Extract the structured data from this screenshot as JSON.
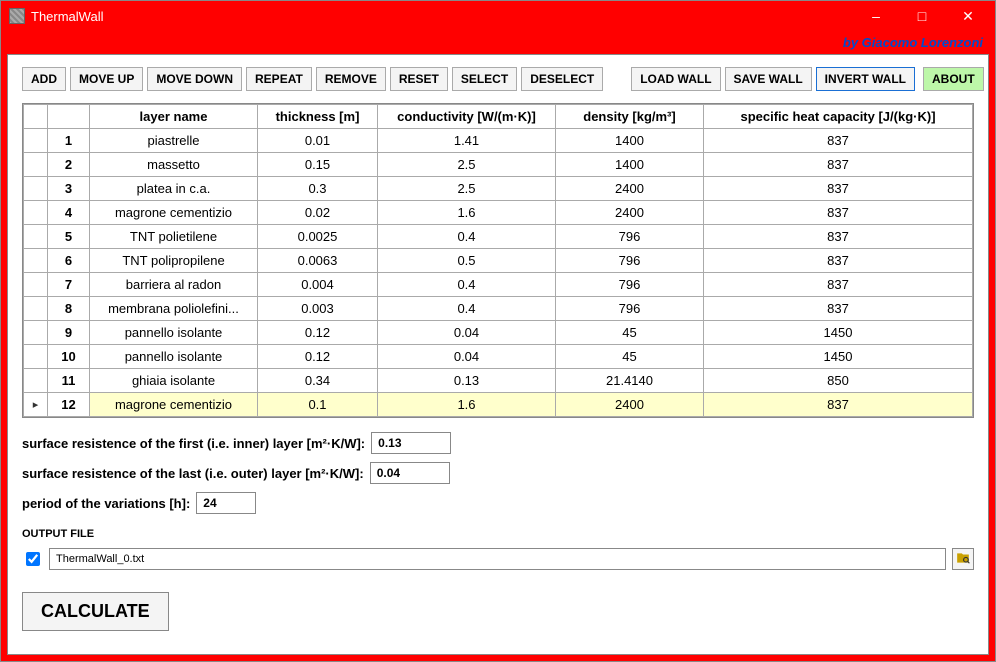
{
  "window": {
    "title": "ThermalWall",
    "credit": "by Giacomo Lorenzoni"
  },
  "toolbar": {
    "add": "ADD",
    "move_up": "MOVE UP",
    "move_down": "MOVE DOWN",
    "repeat": "REPEAT",
    "remove": "REMOVE",
    "reset": "RESET",
    "select": "SELECT",
    "deselect": "DESELECT",
    "load": "LOAD WALL",
    "save": "SAVE WALL",
    "invert": "INVERT WALL",
    "about": "ABOUT"
  },
  "table": {
    "headers": {
      "layer_name": "layer name",
      "thickness": "thickness  [m]",
      "conductivity": "conductivity  [W/(m·K)]",
      "density": "density  [kg/m³]",
      "shc": "specific heat capacity  [J/(kg·K)]"
    },
    "rows": [
      {
        "n": "1",
        "name": "piastrelle",
        "thk": "0.01",
        "cond": "1.41",
        "dens": "1400",
        "shc": "837"
      },
      {
        "n": "2",
        "name": "massetto",
        "thk": "0.15",
        "cond": "2.5",
        "dens": "1400",
        "shc": "837"
      },
      {
        "n": "3",
        "name": "platea in c.a.",
        "thk": "0.3",
        "cond": "2.5",
        "dens": "2400",
        "shc": "837"
      },
      {
        "n": "4",
        "name": "magrone cementizio",
        "thk": "0.02",
        "cond": "1.6",
        "dens": "2400",
        "shc": "837"
      },
      {
        "n": "5",
        "name": "TNT polietilene",
        "thk": "0.0025",
        "cond": "0.4",
        "dens": "796",
        "shc": "837"
      },
      {
        "n": "6",
        "name": "TNT polipropilene",
        "thk": "0.0063",
        "cond": "0.5",
        "dens": "796",
        "shc": "837"
      },
      {
        "n": "7",
        "name": "barriera al radon",
        "thk": "0.004",
        "cond": "0.4",
        "dens": "796",
        "shc": "837"
      },
      {
        "n": "8",
        "name": "membrana poliolefini...",
        "thk": "0.003",
        "cond": "0.4",
        "dens": "796",
        "shc": "837"
      },
      {
        "n": "9",
        "name": "pannello isolante",
        "thk": "0.12",
        "cond": "0.04",
        "dens": "45",
        "shc": "1450"
      },
      {
        "n": "10",
        "name": "pannello isolante",
        "thk": "0.12",
        "cond": "0.04",
        "dens": "45",
        "shc": "1450"
      },
      {
        "n": "11",
        "name": "ghiaia isolante",
        "thk": "0.34",
        "cond": "0.13",
        "dens": "21.4140",
        "shc": "850"
      },
      {
        "n": "12",
        "name": "magrone cementizio",
        "thk": "0.1",
        "cond": "1.6",
        "dens": "2400",
        "shc": "837",
        "selected": true,
        "marker": "▸"
      }
    ]
  },
  "inputs": {
    "rsi_label": "surface resistence of the first (i.e. inner) layer [m²·K/W]:",
    "rsi_value": "0.13",
    "rse_label": "surface resistence of the last (i.e. outer) layer [m²·K/W]:",
    "rse_value": "0.04",
    "period_label": "period of the variations [h]:",
    "period_value": "24",
    "output_label": "OUTPUT FILE",
    "output_checked": true,
    "output_path": "ThermalWall_0.txt"
  },
  "buttons": {
    "calculate": "CALCULATE"
  }
}
